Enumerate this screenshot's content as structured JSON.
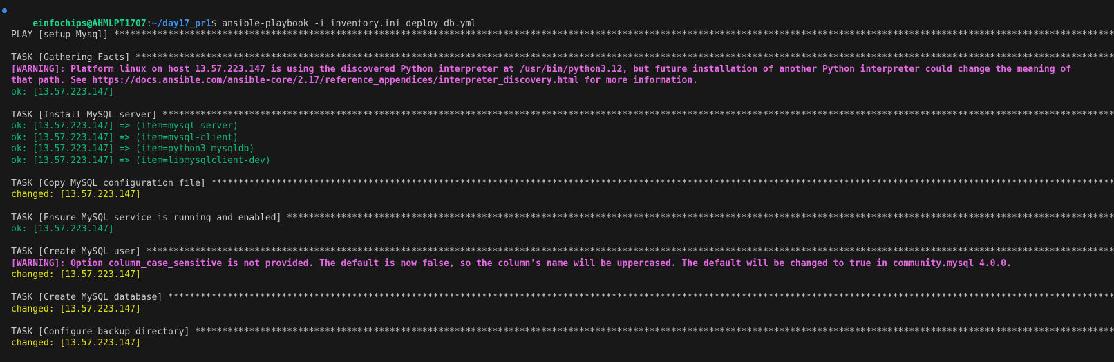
{
  "prompt": {
    "user_host": "einfochips@AHMLPT1707",
    "separator": ":",
    "path": "~/day17_pr1",
    "symbol": "$ ",
    "command": "ansible-playbook -i inventory.ini deploy_db.yml"
  },
  "output": {
    "play_header": "PLAY [setup Mysql] *******************************************************************************************************************************************************************************************",
    "task_gathering": "TASK [Gathering Facts] ***************************************************************************************************************************************************************************************",
    "warning_python_1": "[WARNING]: Platform linux on host 13.57.223.147 is using the discovered Python interpreter at /usr/bin/python3.12, but future installation of another Python interpreter could change the meaning of",
    "warning_python_2": "that path. See https://docs.ansible.com/ansible-core/2.17/reference_appendices/interpreter_discovery.html for more information.",
    "ok_gathering": "ok: [13.57.223.147]",
    "task_install": "TASK [Install MySQL server] **********************************************************************************************************************************************************************************",
    "install_item_1": "ok: [13.57.223.147] => (item=mysql-server)",
    "install_item_2": "ok: [13.57.223.147] => (item=mysql-client)",
    "install_item_3": "ok: [13.57.223.147] => (item=python3-mysqldb)",
    "install_item_4": "ok: [13.57.223.147] => (item=libmysqlclient-dev)",
    "task_copy": "TASK [Copy MySQL configuration file] *************************************************************************************************************************************************************************",
    "changed_copy": "changed: [13.57.223.147]",
    "task_ensure": "TASK [Ensure MySQL service is running and enabled] ***********************************************************************************************************************************************************",
    "ok_ensure": "ok: [13.57.223.147]",
    "task_user": "TASK [Create MySQL user] *********************************************************************************************************************************************************************************************",
    "warning_column": "[WARNING]: Option column_case_sensitive is not provided. The default is now false, so the column's name will be uppercased. The default will be changed to true in community.mysql 4.0.0.",
    "changed_user": "changed: [13.57.223.147]",
    "task_database": "TASK [Create MySQL database] *****************************************************************************************************************************************************************************************",
    "changed_database": "changed: [13.57.223.147]",
    "task_backup": "TASK [Configure backup directory] ************************************************************************************************************************************************************************************",
    "changed_backup": "changed: [13.57.223.147]"
  },
  "colors": {
    "background": "#181818",
    "text": "#cccccc",
    "user": "#23d18b",
    "path": "#3b8eea",
    "ok": "#0dbc79",
    "changed": "#e5e510",
    "warning": "#e36ae3"
  }
}
